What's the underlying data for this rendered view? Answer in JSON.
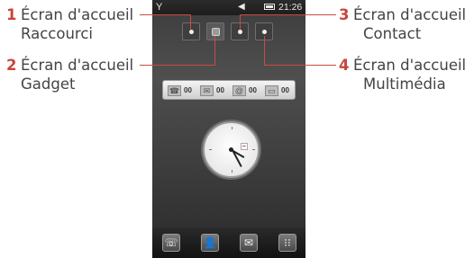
{
  "callouts": [
    {
      "number": "1",
      "line1": "Écran d'accueil",
      "line2": "Raccourci"
    },
    {
      "number": "2",
      "line1": "Écran d'accueil",
      "line2": "Gadget"
    },
    {
      "number": "3",
      "line1": "Écran d'accueil",
      "line2": "Contact"
    },
    {
      "number": "4",
      "line1": "Écran d'accueil",
      "line2": "Multimédia"
    }
  ],
  "status_bar": {
    "time": "21:26",
    "signal_icon": "antenna-icon",
    "volume_icon": "speaker-icon",
    "battery_icon": "battery-icon"
  },
  "notifications": [
    {
      "icon": "call-log-icon",
      "count": "00"
    },
    {
      "icon": "message-icon",
      "count": "00"
    },
    {
      "icon": "email-icon",
      "count": "00"
    },
    {
      "icon": "voicemail-icon",
      "count": "00"
    }
  ],
  "dock": [
    {
      "icon": "phone-icon",
      "glyph": "☏"
    },
    {
      "icon": "contacts-icon",
      "glyph": "👤"
    },
    {
      "icon": "messaging-icon",
      "glyph": "✉"
    },
    {
      "icon": "menu-icon",
      "glyph": "⁝⁝"
    }
  ],
  "colors": {
    "accent": "#c8453c",
    "label_text": "#444444",
    "phone_bg": "#454545"
  }
}
